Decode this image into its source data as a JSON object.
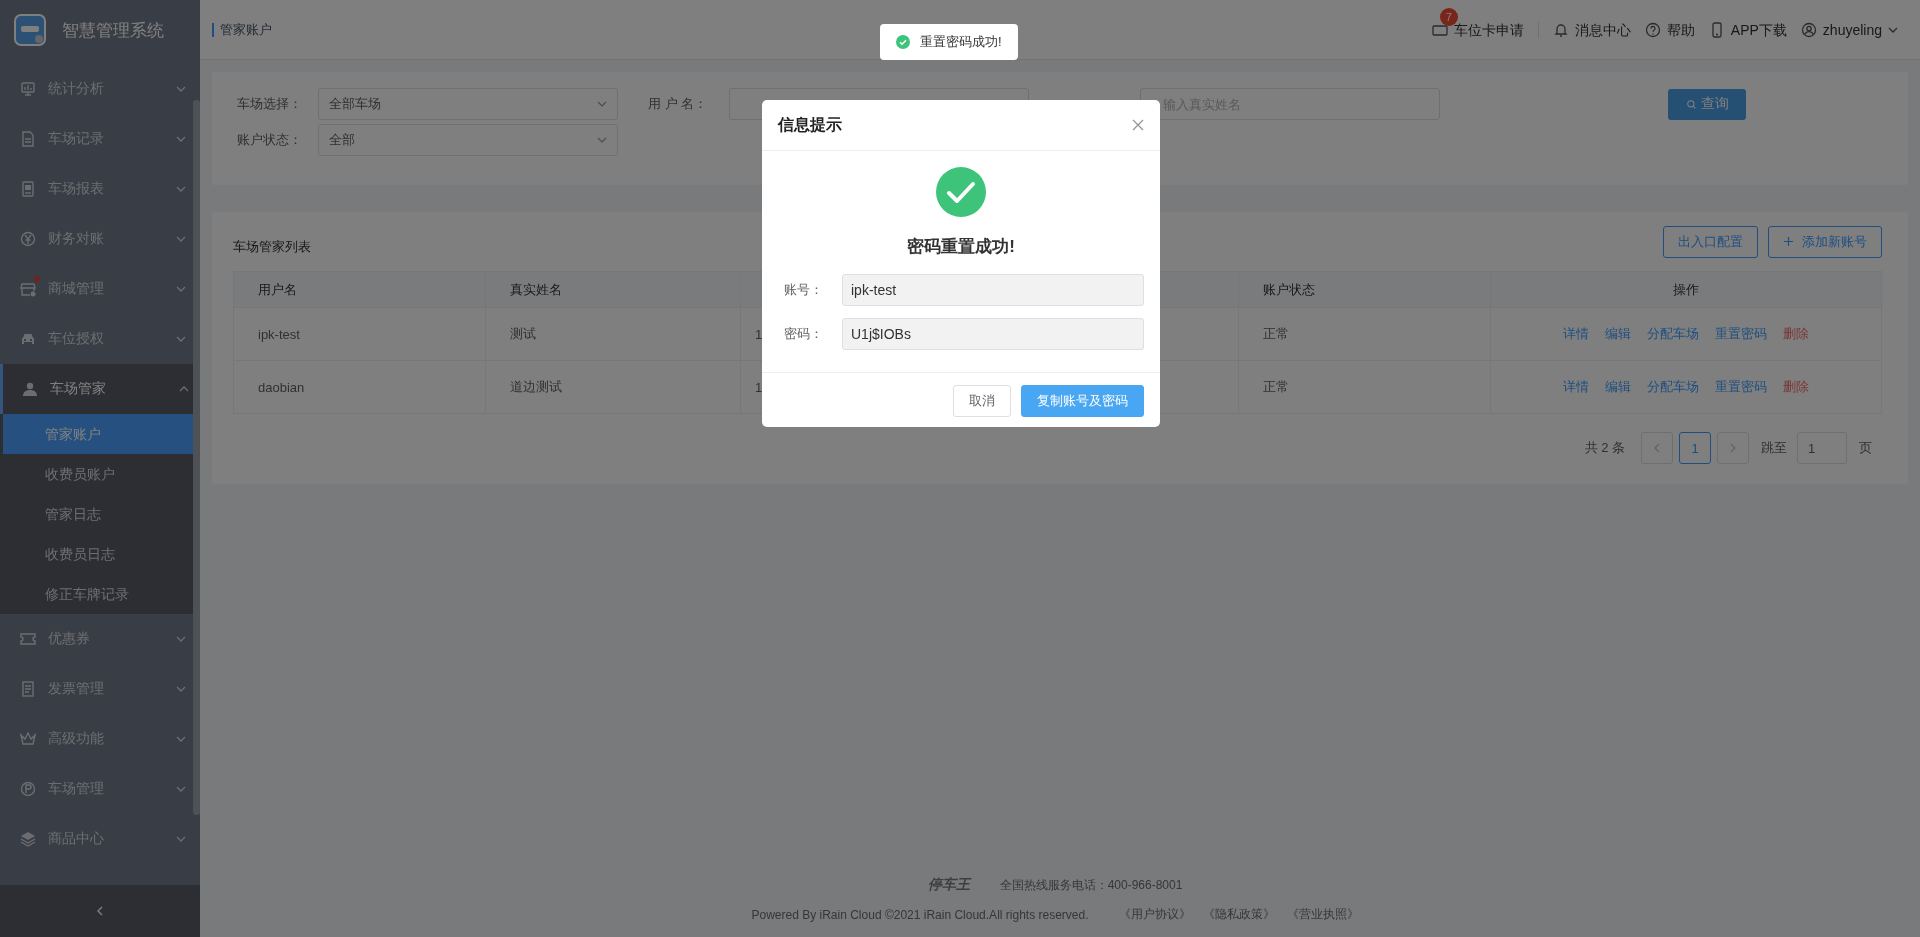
{
  "app": {
    "title": "智慧管理系统"
  },
  "breadcrumb": "管家账户",
  "header": {
    "badge": "7",
    "items": [
      "车位卡申请",
      "消息中心",
      "帮助",
      "APP下载"
    ],
    "user": "zhuyeling"
  },
  "sidebar": {
    "items": [
      {
        "label": "统计分析",
        "expanded": false
      },
      {
        "label": "车场记录",
        "expanded": false
      },
      {
        "label": "车场报表",
        "expanded": false
      },
      {
        "label": "财务对账",
        "expanded": false
      },
      {
        "label": "商城管理",
        "expanded": false,
        "dot": true
      },
      {
        "label": "车位授权",
        "expanded": false
      },
      {
        "label": "车场管家",
        "expanded": true,
        "children": [
          {
            "label": "管家账户",
            "selected": true
          },
          {
            "label": "收费员账户",
            "selected": false
          },
          {
            "label": "管家日志",
            "selected": false
          },
          {
            "label": "收费员日志",
            "selected": false
          },
          {
            "label": "修正车牌记录",
            "selected": false
          }
        ]
      },
      {
        "label": "优惠券",
        "expanded": false
      },
      {
        "label": "发票管理",
        "expanded": false
      },
      {
        "label": "高级功能",
        "expanded": false
      },
      {
        "label": "车场管理",
        "expanded": false
      },
      {
        "label": "商品中心",
        "expanded": false
      }
    ]
  },
  "filters": {
    "park_label": "车场选择：",
    "park_value": "全部车场",
    "user_label": "用 户 名：",
    "realname_placeholder": "输入真实姓名",
    "status_label": "账户状态：",
    "status_value": "全部",
    "search_button": "查询"
  },
  "table": {
    "title": "车场管家列表",
    "buttons": [
      "出入口配置",
      "添加新账号"
    ],
    "columns": [
      "用户名",
      "真实姓名",
      "",
      "账户状态",
      "操作"
    ],
    "rows": [
      {
        "cells": [
          "ipk-test",
          "测试",
          "1",
          "正常"
        ],
        "actions": [
          {
            "label": "详情",
            "kind": "normal"
          },
          {
            "label": "编辑",
            "kind": "normal"
          },
          {
            "label": "分配车场",
            "kind": "normal"
          },
          {
            "label": "重置密码",
            "kind": "normal"
          },
          {
            "label": "删除",
            "kind": "danger"
          }
        ]
      },
      {
        "cells": [
          "daobian",
          "道边测试",
          "1",
          "正常"
        ],
        "actions": [
          {
            "label": "详情",
            "kind": "normal"
          },
          {
            "label": "编辑",
            "kind": "normal"
          },
          {
            "label": "分配车场",
            "kind": "normal"
          },
          {
            "label": "重置密码",
            "kind": "normal"
          },
          {
            "label": "删除",
            "kind": "danger"
          }
        ]
      }
    ]
  },
  "pagination": {
    "total": "共 2 条",
    "pages": [
      {
        "label": "1",
        "selected": true
      }
    ],
    "jump_label": "跳至",
    "jump_value": "1",
    "page_unit": "页"
  },
  "footer": {
    "logo": "停车王",
    "hotline": "全国热线服务电话：400-966-8001",
    "copyright": "Powered By iRain Cloud ©2021 iRain Cloud.All rights reserved.",
    "links": [
      "《用户协议》",
      "《隐私政策》",
      "《营业执照》"
    ]
  },
  "dialog": {
    "title": "信息提示",
    "message": "密码重置成功!",
    "fields": [
      {
        "label": "账号：",
        "value": "ipk-test"
      },
      {
        "label": "密码：",
        "value": "U1j$IOBs"
      }
    ],
    "buttons": [
      {
        "label": "取消",
        "kind": "default"
      },
      {
        "label": "复制账号及密码",
        "kind": "primary"
      }
    ]
  },
  "toast": {
    "text": "重置密码成功!"
  }
}
